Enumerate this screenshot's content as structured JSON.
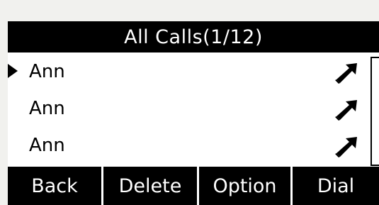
{
  "header": {
    "title": "All Calls(1/12)"
  },
  "calls": [
    {
      "name": "Ann",
      "selected": true,
      "icon": "outgoing-call-arrow-icon"
    },
    {
      "name": "Ann",
      "selected": false,
      "icon": "outgoing-call-arrow-icon"
    },
    {
      "name": "Ann",
      "selected": false,
      "icon": "outgoing-call-arrow-icon"
    }
  ],
  "softkeys": {
    "back": "Back",
    "delete": "Delete",
    "option": "Option",
    "dial": "Dial"
  },
  "colors": {
    "screen_background": "#ffffff",
    "bar_background": "#000000",
    "bar_text": "#ffffff",
    "frame_background": "#f1f1ee"
  }
}
